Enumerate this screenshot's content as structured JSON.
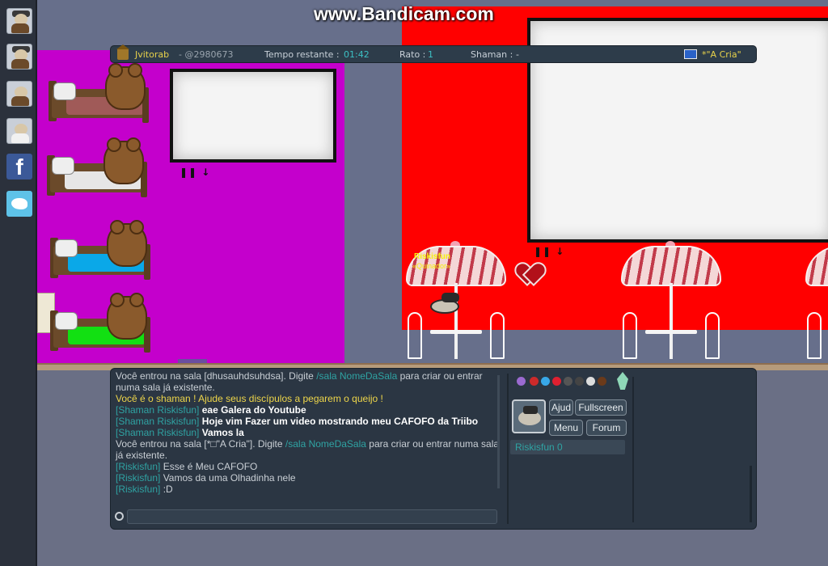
{
  "watermark": "www.Bandicam.com",
  "topbar": {
    "player": "Jvitorab",
    "player_id": "- @2980673",
    "time_label": "Tempo restante :",
    "time_value": "01:42",
    "rato_label": "Rato :",
    "rato_value": "1",
    "shaman_label": "Shaman :",
    "shaman_value": "-",
    "room": "*\"A Cria\""
  },
  "player_tag": {
    "name": "Riskisfun",
    "title": "«Quinador»"
  },
  "chat": {
    "lines": [
      {
        "segments": [
          {
            "t": "Você entrou na sala [dhusauhdsuhdsa]. Digite ",
            "c": "plain"
          },
          {
            "t": "/sala NomeDaSala",
            "c": "who"
          },
          {
            "t": " para criar ou entrar numa sala já existente.",
            "c": "plain"
          }
        ]
      },
      {
        "segments": [
          {
            "t": "Você é o shaman ! Ajude seus discípulos a pegarem o queijo !",
            "c": "yel"
          }
        ]
      },
      {
        "segments": [
          {
            "t": "[Shaman Riskisfun] ",
            "c": "sh"
          },
          {
            "t": "eae Galera do Youtube",
            "c": "bold"
          }
        ]
      },
      {
        "segments": [
          {
            "t": "[Shaman Riskisfun] ",
            "c": "sh"
          },
          {
            "t": "Hoje vim Fazer um video mostrando meu CAFOFO da Triibo",
            "c": "bold"
          }
        ]
      },
      {
        "segments": [
          {
            "t": "[Shaman Riskisfun] ",
            "c": "sh"
          },
          {
            "t": "Vamos la",
            "c": "bold"
          }
        ]
      },
      {
        "segments": [
          {
            "t": "Você entrou na sala [*□\"A Cria\"]. Digite ",
            "c": "plain"
          },
          {
            "t": "/sala NomeDaSala",
            "c": "who"
          },
          {
            "t": " para criar ou entrar numa sala já existente.",
            "c": "plain"
          }
        ]
      },
      {
        "segments": [
          {
            "t": "[Riskisfun] ",
            "c": "who"
          },
          {
            "t": "Esse é Meu CAFOFO",
            "c": "plain"
          }
        ]
      },
      {
        "segments": [
          {
            "t": "[Riskisfun] ",
            "c": "who"
          },
          {
            "t": "Vamos da uma Olhadinha nele",
            "c": "plain"
          }
        ]
      },
      {
        "segments": [
          {
            "t": "[Riskisfun] ",
            "c": "who"
          },
          {
            "t": ":D",
            "c": "plain"
          }
        ]
      }
    ],
    "input_value": ""
  },
  "side": {
    "buttons": {
      "help": "Ajud",
      "fullscreen": "Fullscreen",
      "menu": "Menu",
      "forum": "Forum"
    },
    "player_entry": "Riskisfun  0"
  },
  "rail": {
    "facebook_glyph": "f"
  },
  "colors": {
    "magenta_room": "#c400cc",
    "red_room": "#ff0000",
    "ui_panel": "#2b3643",
    "accent_cyan": "#2fa3a3",
    "accent_yellow": "#eed64a"
  },
  "icons": [
    "house-icon",
    "flag-icon",
    "chat-bubble-icon",
    "facebook-icon",
    "twitter-icon",
    "crystal-icon"
  ]
}
